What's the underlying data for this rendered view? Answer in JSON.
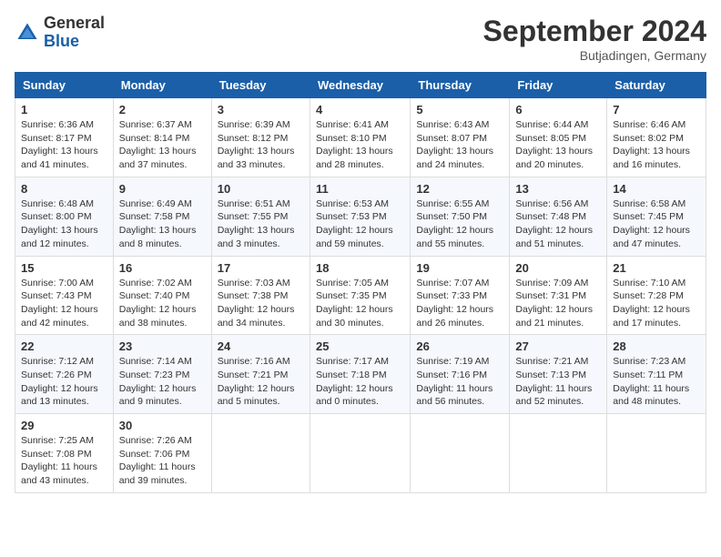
{
  "header": {
    "logo_general": "General",
    "logo_blue": "Blue",
    "month_title": "September 2024",
    "subtitle": "Butjadingen, Germany"
  },
  "calendar": {
    "days": [
      "Sunday",
      "Monday",
      "Tuesday",
      "Wednesday",
      "Thursday",
      "Friday",
      "Saturday"
    ],
    "weeks": [
      [
        {
          "day": "1",
          "sunrise": "6:36 AM",
          "sunset": "8:17 PM",
          "daylight": "13 hours and 41 minutes."
        },
        {
          "day": "2",
          "sunrise": "6:37 AM",
          "sunset": "8:14 PM",
          "daylight": "13 hours and 37 minutes."
        },
        {
          "day": "3",
          "sunrise": "6:39 AM",
          "sunset": "8:12 PM",
          "daylight": "13 hours and 33 minutes."
        },
        {
          "day": "4",
          "sunrise": "6:41 AM",
          "sunset": "8:10 PM",
          "daylight": "13 hours and 28 minutes."
        },
        {
          "day": "5",
          "sunrise": "6:43 AM",
          "sunset": "8:07 PM",
          "daylight": "13 hours and 24 minutes."
        },
        {
          "day": "6",
          "sunrise": "6:44 AM",
          "sunset": "8:05 PM",
          "daylight": "13 hours and 20 minutes."
        },
        {
          "day": "7",
          "sunrise": "6:46 AM",
          "sunset": "8:02 PM",
          "daylight": "13 hours and 16 minutes."
        }
      ],
      [
        {
          "day": "8",
          "sunrise": "6:48 AM",
          "sunset": "8:00 PM",
          "daylight": "13 hours and 12 minutes."
        },
        {
          "day": "9",
          "sunrise": "6:49 AM",
          "sunset": "7:58 PM",
          "daylight": "13 hours and 8 minutes."
        },
        {
          "day": "10",
          "sunrise": "6:51 AM",
          "sunset": "7:55 PM",
          "daylight": "13 hours and 3 minutes."
        },
        {
          "day": "11",
          "sunrise": "6:53 AM",
          "sunset": "7:53 PM",
          "daylight": "12 hours and 59 minutes."
        },
        {
          "day": "12",
          "sunrise": "6:55 AM",
          "sunset": "7:50 PM",
          "daylight": "12 hours and 55 minutes."
        },
        {
          "day": "13",
          "sunrise": "6:56 AM",
          "sunset": "7:48 PM",
          "daylight": "12 hours and 51 minutes."
        },
        {
          "day": "14",
          "sunrise": "6:58 AM",
          "sunset": "7:45 PM",
          "daylight": "12 hours and 47 minutes."
        }
      ],
      [
        {
          "day": "15",
          "sunrise": "7:00 AM",
          "sunset": "7:43 PM",
          "daylight": "12 hours and 42 minutes."
        },
        {
          "day": "16",
          "sunrise": "7:02 AM",
          "sunset": "7:40 PM",
          "daylight": "12 hours and 38 minutes."
        },
        {
          "day": "17",
          "sunrise": "7:03 AM",
          "sunset": "7:38 PM",
          "daylight": "12 hours and 34 minutes."
        },
        {
          "day": "18",
          "sunrise": "7:05 AM",
          "sunset": "7:35 PM",
          "daylight": "12 hours and 30 minutes."
        },
        {
          "day": "19",
          "sunrise": "7:07 AM",
          "sunset": "7:33 PM",
          "daylight": "12 hours and 26 minutes."
        },
        {
          "day": "20",
          "sunrise": "7:09 AM",
          "sunset": "7:31 PM",
          "daylight": "12 hours and 21 minutes."
        },
        {
          "day": "21",
          "sunrise": "7:10 AM",
          "sunset": "7:28 PM",
          "daylight": "12 hours and 17 minutes."
        }
      ],
      [
        {
          "day": "22",
          "sunrise": "7:12 AM",
          "sunset": "7:26 PM",
          "daylight": "12 hours and 13 minutes."
        },
        {
          "day": "23",
          "sunrise": "7:14 AM",
          "sunset": "7:23 PM",
          "daylight": "12 hours and 9 minutes."
        },
        {
          "day": "24",
          "sunrise": "7:16 AM",
          "sunset": "7:21 PM",
          "daylight": "12 hours and 5 minutes."
        },
        {
          "day": "25",
          "sunrise": "7:17 AM",
          "sunset": "7:18 PM",
          "daylight": "12 hours and 0 minutes."
        },
        {
          "day": "26",
          "sunrise": "7:19 AM",
          "sunset": "7:16 PM",
          "daylight": "11 hours and 56 minutes."
        },
        {
          "day": "27",
          "sunrise": "7:21 AM",
          "sunset": "7:13 PM",
          "daylight": "11 hours and 52 minutes."
        },
        {
          "day": "28",
          "sunrise": "7:23 AM",
          "sunset": "7:11 PM",
          "daylight": "11 hours and 48 minutes."
        }
      ],
      [
        {
          "day": "29",
          "sunrise": "7:25 AM",
          "sunset": "7:08 PM",
          "daylight": "11 hours and 43 minutes."
        },
        {
          "day": "30",
          "sunrise": "7:26 AM",
          "sunset": "7:06 PM",
          "daylight": "11 hours and 39 minutes."
        },
        null,
        null,
        null,
        null,
        null
      ]
    ]
  }
}
